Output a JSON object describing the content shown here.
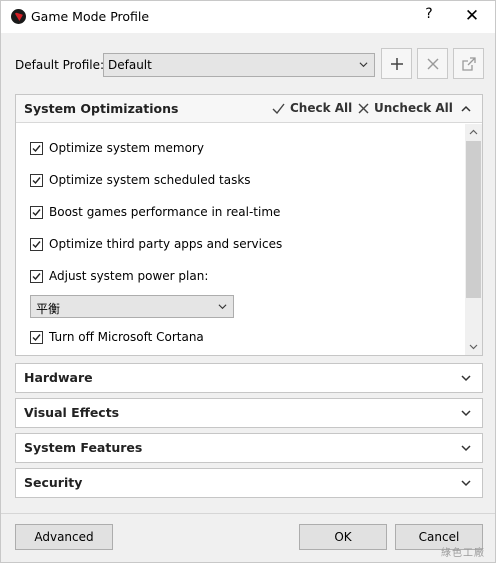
{
  "window": {
    "title": "Game Mode Profile",
    "help_glyph": "?",
    "close_glyph": "✕"
  },
  "profile": {
    "label": "Default Profile:",
    "value": "Default"
  },
  "system_optimizations": {
    "title": "System Optimizations",
    "check_all": "Check All",
    "uncheck_all": "Uncheck All",
    "options": [
      {
        "label": "Optimize system memory",
        "checked": true
      },
      {
        "label": "Optimize system scheduled tasks",
        "checked": true
      },
      {
        "label": "Boost games performance in real-time",
        "checked": true
      },
      {
        "label": "Optimize third party apps and services",
        "checked": true
      },
      {
        "label": "Adjust system power plan:",
        "checked": true
      },
      {
        "label": "Turn off Microsoft Cortana",
        "checked": true
      }
    ],
    "power_plan": "平衡"
  },
  "sections": [
    "Hardware",
    "Visual Effects",
    "System Features",
    "Security"
  ],
  "footer": {
    "advanced": "Advanced",
    "ok": "OK",
    "cancel": "Cancel"
  },
  "watermark": "綠色工廠",
  "colors": {
    "accent_red": "#d41f26",
    "panel_border": "#c6c6c6",
    "button_face": "#e1e1e1"
  }
}
